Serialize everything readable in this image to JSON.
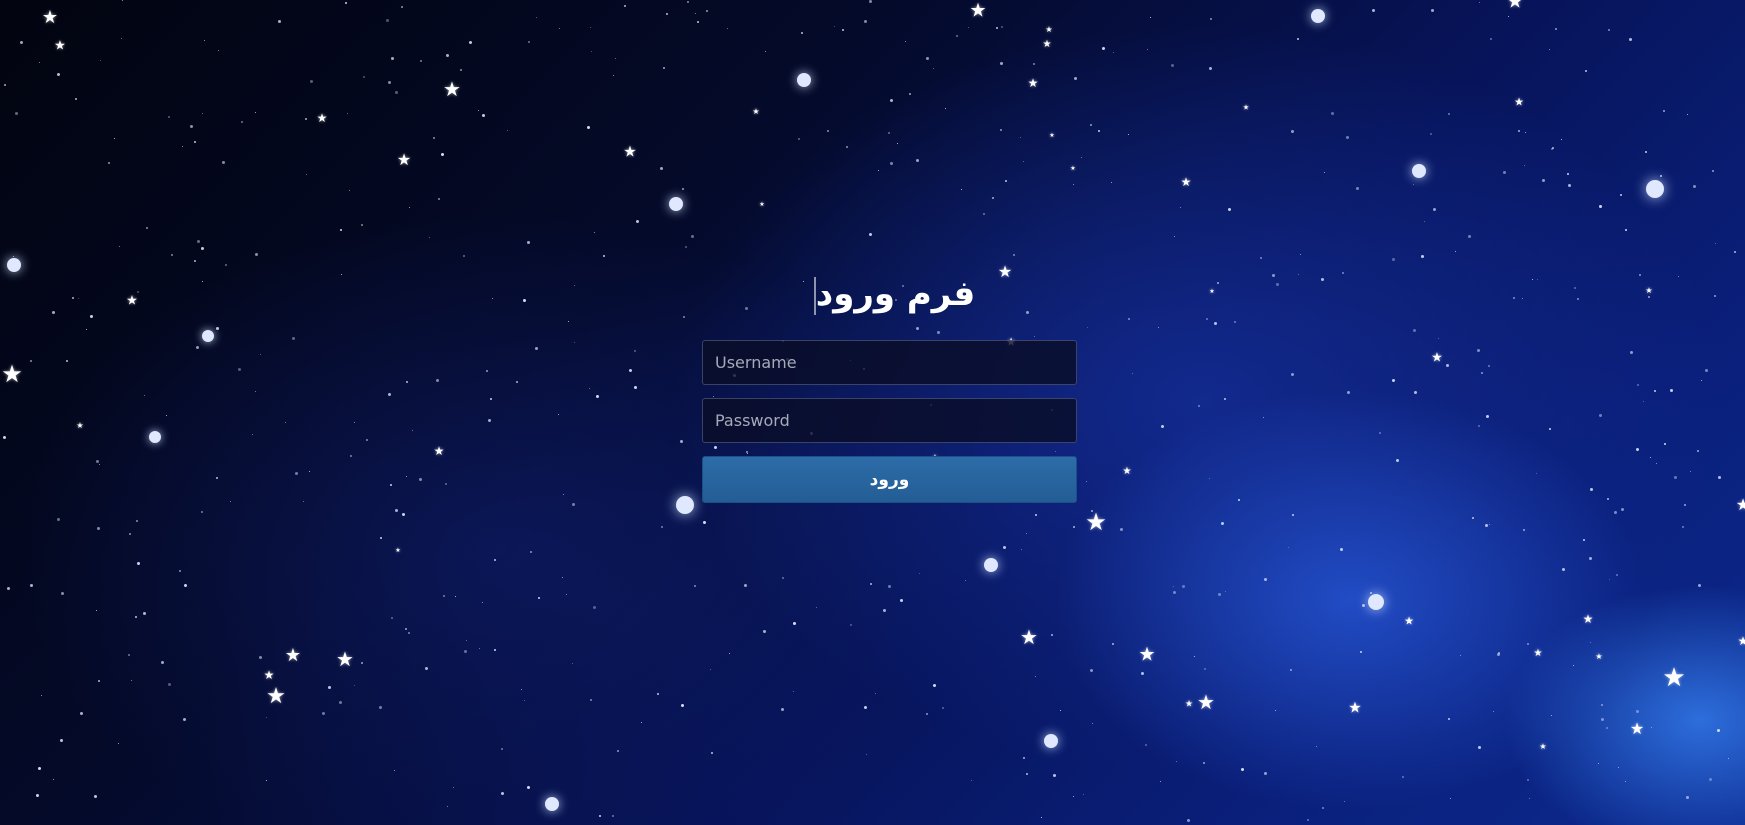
{
  "form": {
    "title": "فرم ورود",
    "username_placeholder": "Username",
    "password_placeholder": "Password",
    "submit_label": "ورود"
  },
  "background": {
    "theme": "starry night sky",
    "colors": [
      "#02040f",
      "#07145a",
      "#0c2a8f"
    ],
    "star_color": "#ffffff",
    "star_icon": "star-icon"
  },
  "colors": {
    "button": "#2a6499",
    "input_background": "#0a0e28",
    "text": "#ffffff"
  }
}
